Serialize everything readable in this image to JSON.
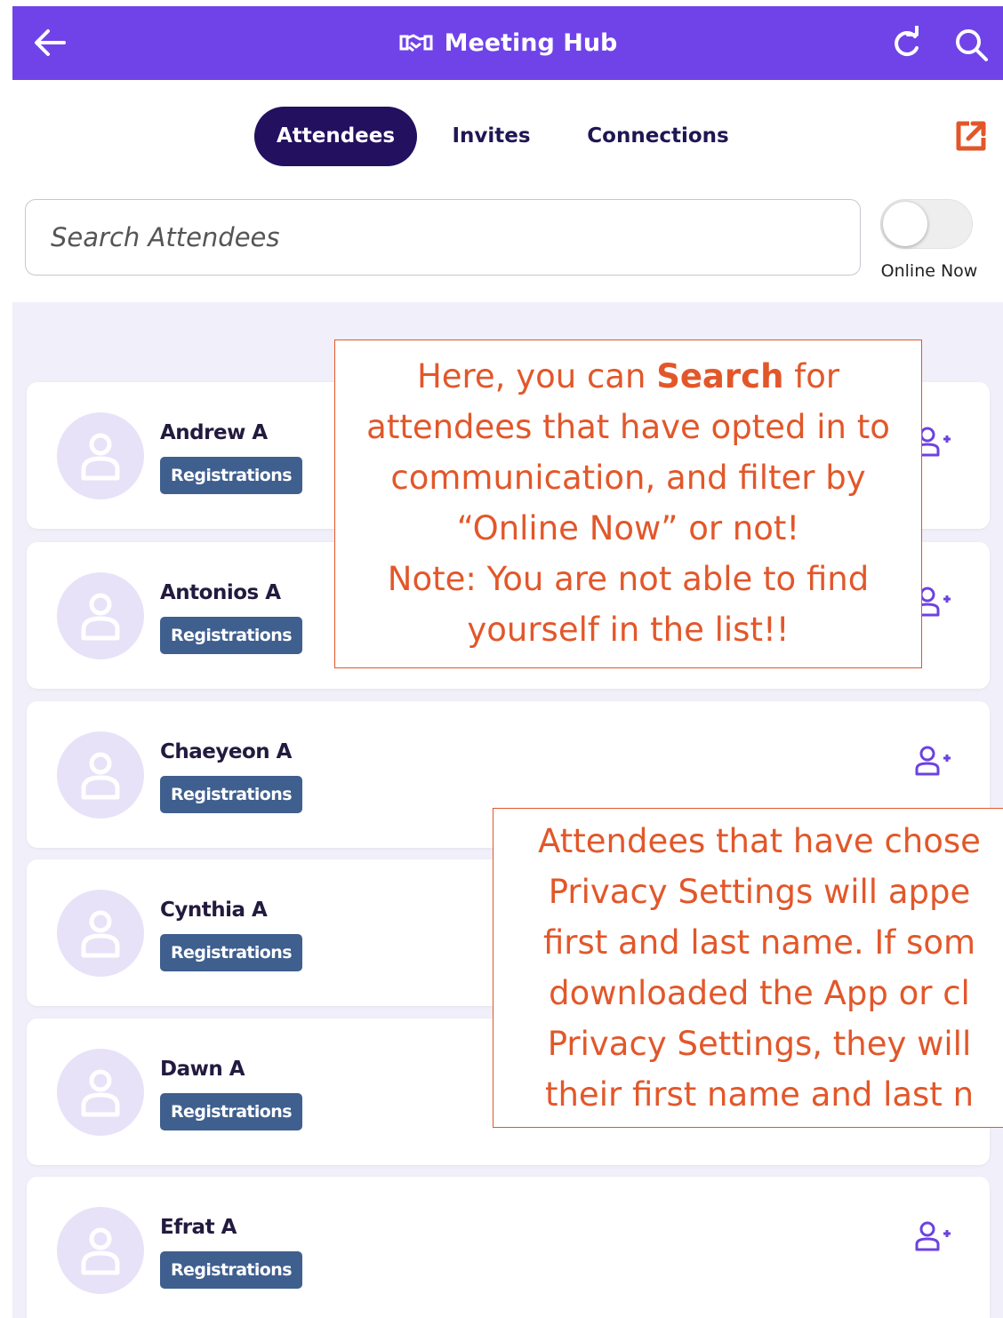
{
  "header": {
    "title": "Meeting Hub",
    "icons": [
      "back-arrow-icon",
      "handshake-icon",
      "refresh-icon",
      "search-icon"
    ]
  },
  "tabs": [
    {
      "label": "Attendees",
      "active": true
    },
    {
      "label": "Invites",
      "active": false
    },
    {
      "label": "Connections",
      "active": false
    }
  ],
  "search": {
    "placeholder": "Search Attendees",
    "value": ""
  },
  "online_toggle": {
    "label": "Online Now",
    "checked": false
  },
  "attendees": [
    {
      "name": "Andrew A",
      "badge": "Registrations"
    },
    {
      "name": "Antonios A",
      "badge": "Registrations"
    },
    {
      "name": "Chaeyeon A",
      "badge": "Registrations"
    },
    {
      "name": "Cynthia A",
      "badge": "Registrations"
    },
    {
      "name": "Dawn A",
      "badge": "Registrations"
    },
    {
      "name": "Efrat A",
      "badge": "Registrations"
    }
  ],
  "callouts": {
    "search_tip": {
      "part1": "Here, you can ",
      "bold": "Search",
      "part2": " for attendees that have opted in to communication, and filter by “Online Now” or not!",
      "note": "Note: You are not able to find yourself in the list!!"
    },
    "privacy_tip": {
      "lines": [
        "Attendees that have chose",
        "Privacy Settings will appe",
        "first and last name. If som",
        "downloaded the App or cl",
        "Privacy Settings, they will",
        "their first name and last n"
      ]
    }
  },
  "colors": {
    "header_bg": "#7043e8",
    "active_tab_bg": "#23105f",
    "badge_bg": "#3f5f8e",
    "callout_color": "#e2572a",
    "list_bg": "#f1eff9",
    "avatar_bg": "#e7e2f8"
  }
}
